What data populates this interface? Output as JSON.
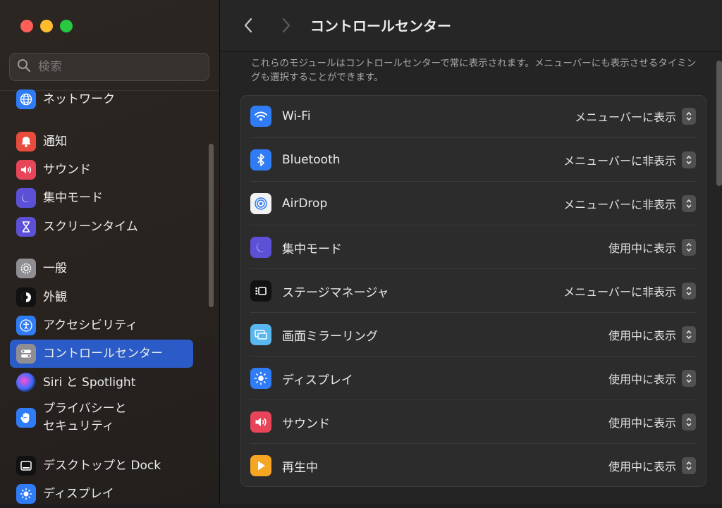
{
  "window": {
    "traffic_lights": [
      "close",
      "minimize",
      "maximize"
    ]
  },
  "sidebar": {
    "search_placeholder": "検索",
    "items": [
      {
        "label": "ネットワーク",
        "icon": "globe-icon",
        "color": "#2f7cf6"
      },
      {
        "label": "通知",
        "icon": "bell-icon",
        "color": "#e94b3c"
      },
      {
        "label": "サウンド",
        "icon": "speaker-icon",
        "color": "#e8455a"
      },
      {
        "label": "集中モード",
        "icon": "moon-icon",
        "color": "#5b50d6"
      },
      {
        "label": "スクリーンタイム",
        "icon": "hourglass-icon",
        "color": "#5b50d6"
      },
      {
        "label": "一般",
        "icon": "gear-icon",
        "color": "#8e8e93"
      },
      {
        "label": "外観",
        "icon": "appearance-icon",
        "color": "#111111"
      },
      {
        "label": "アクセシビリティ",
        "icon": "accessibility-icon",
        "color": "#2f7cf6"
      },
      {
        "label": "コントロールセンター",
        "icon": "toggles-icon",
        "color": "#8e8e93",
        "selected": true
      },
      {
        "label": "Siri と Spotlight",
        "icon": "siri-icon",
        "color": "#2a2a2a"
      },
      {
        "label": "プライバシーと\nセキュリティ",
        "icon": "hand-icon",
        "color": "#2f7cf6"
      },
      {
        "label": "デスクトップと Dock",
        "icon": "dock-icon",
        "color": "#111111"
      },
      {
        "label": "ディスプレイ",
        "icon": "sun-icon",
        "color": "#2f7cf6"
      }
    ]
  },
  "main": {
    "title": "コントロールセンター",
    "description": "これらのモジュールはコントロールセンターで常に表示されます。メニューバーにも表示させるタイミングも選択することができます。",
    "rows": [
      {
        "label": "Wi-Fi",
        "value": "メニューバーに表示",
        "icon": "wifi-icon",
        "color": "#2f7cf6"
      },
      {
        "label": "Bluetooth",
        "value": "メニューバーに非表示",
        "icon": "bluetooth-icon",
        "color": "#2f7cf6"
      },
      {
        "label": "AirDrop",
        "value": "メニューバーに非表示",
        "icon": "airdrop-icon",
        "color": "#f2f2f2"
      },
      {
        "label": "集中モード",
        "value": "使用中に表示",
        "icon": "moon-icon",
        "color": "#5b50d6"
      },
      {
        "label": "ステージマネージャ",
        "value": "メニューバーに非表示",
        "icon": "stage-manager-icon",
        "color": "#111111"
      },
      {
        "label": "画面ミラーリング",
        "value": "使用中に表示",
        "icon": "screen-mirroring-icon",
        "color": "#5ab8f0"
      },
      {
        "label": "ディスプレイ",
        "value": "使用中に表示",
        "icon": "sun-icon",
        "color": "#2f7cf6"
      },
      {
        "label": "サウンド",
        "value": "使用中に表示",
        "icon": "speaker-icon",
        "color": "#e8455a"
      },
      {
        "label": "再生中",
        "value": "使用中に表示",
        "icon": "play-icon",
        "color": "#f5a623"
      }
    ]
  }
}
